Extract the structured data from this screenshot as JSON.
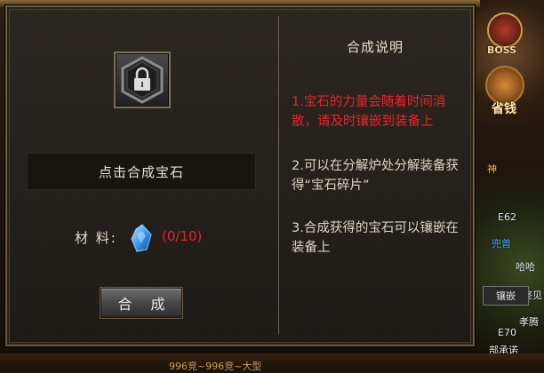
{
  "panel": {
    "prompt_text": "点击合成宝石",
    "material_label": "材 料:",
    "material_count": "(0/10)",
    "compose_button": "合 成",
    "slot_icon": "lock-icon",
    "material_icon": "blue-gem-icon"
  },
  "info": {
    "title": "合成说明",
    "items": [
      {
        "text": "1.宝石的力量会随着时间消散，请及时镶嵌到装备上",
        "color": "#e8242a"
      },
      {
        "text": "2.可以在分解炉处分解装备获得“宝石碎片”",
        "color": "#ddd4c2"
      },
      {
        "text": "3.合成获得的宝石可以镶嵌在装备上",
        "color": "#ddd4c2"
      }
    ]
  },
  "hud": {
    "boss_label": "BOSS",
    "save_label": "省钱",
    "level_label": "E62",
    "level_label_2": "E70",
    "chip_label": "镶嵌",
    "misc_1": "神",
    "misc_2": "兜兽",
    "misc_3": "哈哈",
    "misc_4": "终见",
    "misc_5": "孝腾",
    "misc_6": "部承诺",
    "bottom_ticker": "996竞~996竞~大型"
  }
}
